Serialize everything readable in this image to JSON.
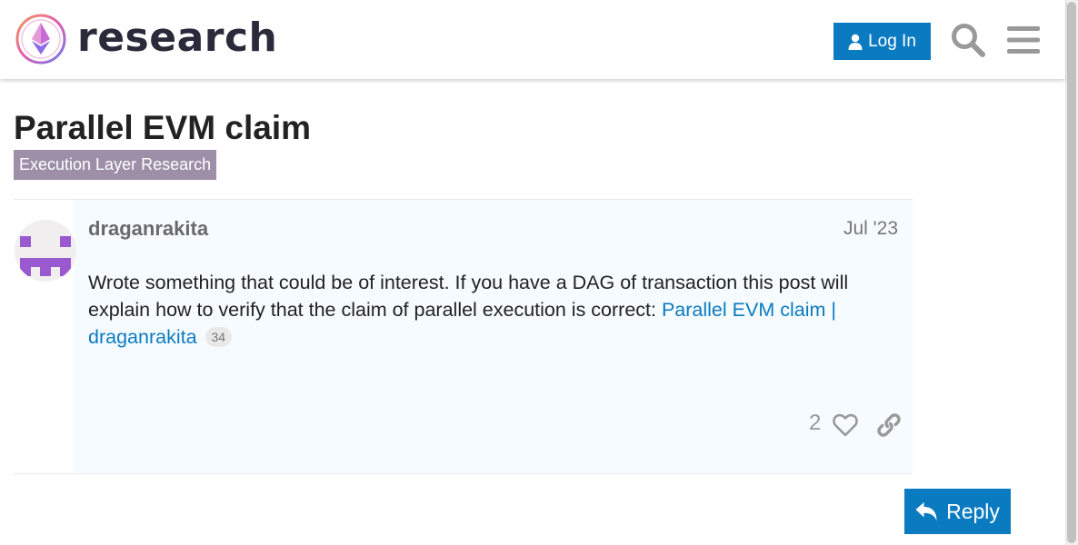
{
  "header": {
    "site_name": "research",
    "login_label": "Log In",
    "icons": {
      "logo": "ethereum-research-logo",
      "search": "search-icon",
      "menu": "hamburger-menu-icon",
      "user": "user-icon"
    }
  },
  "topic": {
    "title": "Parallel EVM claim",
    "category": "Execution Layer Research"
  },
  "post": {
    "username": "draganrakita",
    "date": "Jul '23",
    "text_before": "Wrote something that could be of interest. If you have a DAG of transaction this post will explain how to verify that the claim of parallel execution is correct: ",
    "link_text": "Parallel EVM claim | draganrakita",
    "link_clicks": "34",
    "like_count": "2"
  },
  "actions": {
    "reply_label": "Reply"
  },
  "colors": {
    "accent": "#0b7bc1",
    "category_badge": "#9e8fa8",
    "post_bg": "#f5fbfe",
    "avatar_purple": "#9b59d0"
  }
}
